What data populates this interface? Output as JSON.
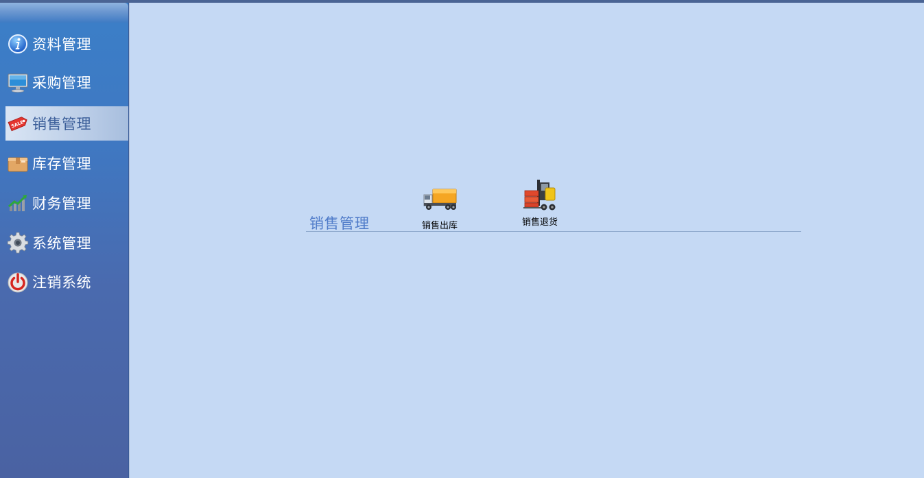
{
  "sidebar": {
    "items": [
      {
        "label": "资料管理",
        "icon": "info-icon",
        "active": false
      },
      {
        "label": "采购管理",
        "icon": "monitor-icon",
        "active": false
      },
      {
        "label": "销售管理",
        "icon": "sale-tag-icon",
        "active": true
      },
      {
        "label": "库存管理",
        "icon": "box-icon",
        "active": false
      },
      {
        "label": "财务管理",
        "icon": "growth-chart-icon",
        "active": false
      },
      {
        "label": "系统管理",
        "icon": "gear-icon",
        "active": false
      },
      {
        "label": "注销系统",
        "icon": "power-icon",
        "active": false
      }
    ]
  },
  "main": {
    "section_title": "销售管理",
    "functions": [
      {
        "label": "销售出库",
        "icon": "delivery-truck-icon"
      },
      {
        "label": "销售退货",
        "icon": "forklift-icon"
      }
    ]
  },
  "colors": {
    "background": "#c5d9f4",
    "sidebar": "#3f78c2",
    "active_item": "#b8cbe6",
    "section_title": "#4f7bc9"
  }
}
